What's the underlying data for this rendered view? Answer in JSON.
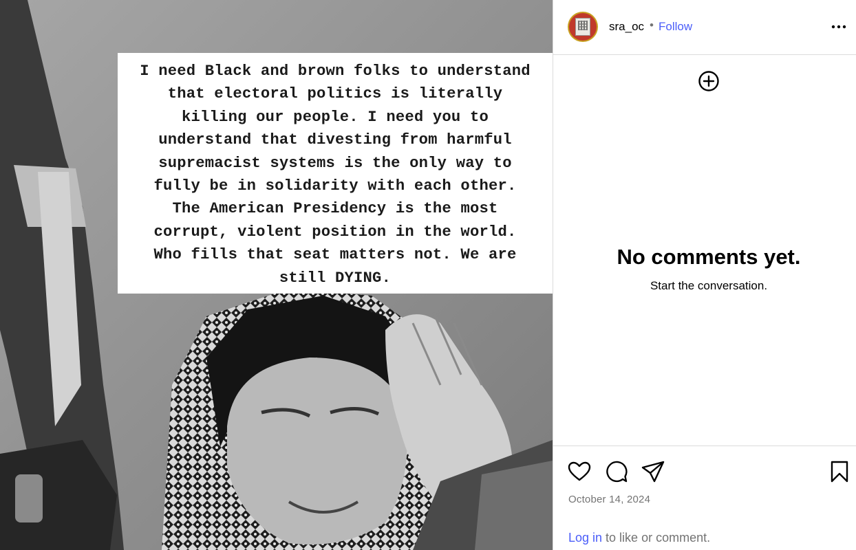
{
  "post": {
    "image_text_lines": [
      "I need Black and brown folks to understand",
      "that electoral politics is literally",
      "killing our people. I need you to",
      "understand that divesting from harmful",
      "supremacist systems is the only way to",
      "fully be in solidarity with each other.",
      "The American Presidency is the most",
      "corrupt, violent position in the world.",
      "Who fills that seat matters not. We are",
      "still DYING."
    ]
  },
  "header": {
    "username": "sra_oc",
    "separator": "•",
    "follow_label": "Follow",
    "more_icon": "more-horizontal-icon"
  },
  "comments": {
    "add_icon": "add-circle-icon",
    "empty_title": "No comments yet.",
    "empty_subtitle": "Start the conversation."
  },
  "actions": {
    "icons": [
      "heart-icon",
      "comment-icon",
      "share-icon",
      "bookmark-icon"
    ],
    "date": "October 14, 2024",
    "login_link": "Log in",
    "login_suffix": " to like or comment."
  },
  "colors": {
    "link": "#4a5df9",
    "muted": "#737373",
    "divider": "#dbdbdb"
  }
}
